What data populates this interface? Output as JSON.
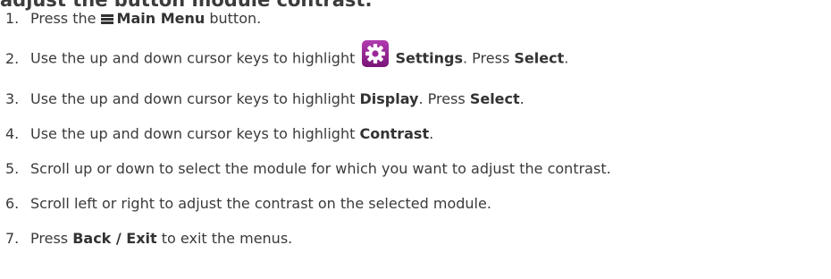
{
  "heading": "adjust the button module contrast.",
  "steps": [
    {
      "number": "1.",
      "parts": {
        "a": "Press the",
        "icon": "main-menu-icon",
        "b": "Main Menu",
        "c": "button."
      }
    },
    {
      "number": "2.",
      "parts": {
        "a": "Use the up and down cursor keys to highlight",
        "icon": "settings-gear-icon",
        "b": "Settings",
        "c": ". Press",
        "d": "Select",
        "e": "."
      }
    },
    {
      "number": "3.",
      "parts": {
        "a": "Use the up and down cursor keys to highlight",
        "b": "Display",
        "c": ". Press",
        "d": "Select",
        "e": "."
      }
    },
    {
      "number": "4.",
      "parts": {
        "a": "Use the up and down cursor keys to highlight",
        "b": "Contrast",
        "c": "."
      }
    },
    {
      "number": "5.",
      "parts": {
        "a": "Scroll up or down to select the module for which you want to adjust the contrast."
      }
    },
    {
      "number": "6.",
      "parts": {
        "a": "Scroll left or right to adjust the contrast on the selected module."
      }
    },
    {
      "number": "7.",
      "parts": {
        "a": "Press",
        "b": "Back / Exit",
        "c": "to exit the menus."
      }
    }
  ],
  "colors": {
    "text": "#3a3a3a",
    "settings_icon_bg": "#8e1f8c",
    "settings_icon_fg": "#ffffff"
  }
}
